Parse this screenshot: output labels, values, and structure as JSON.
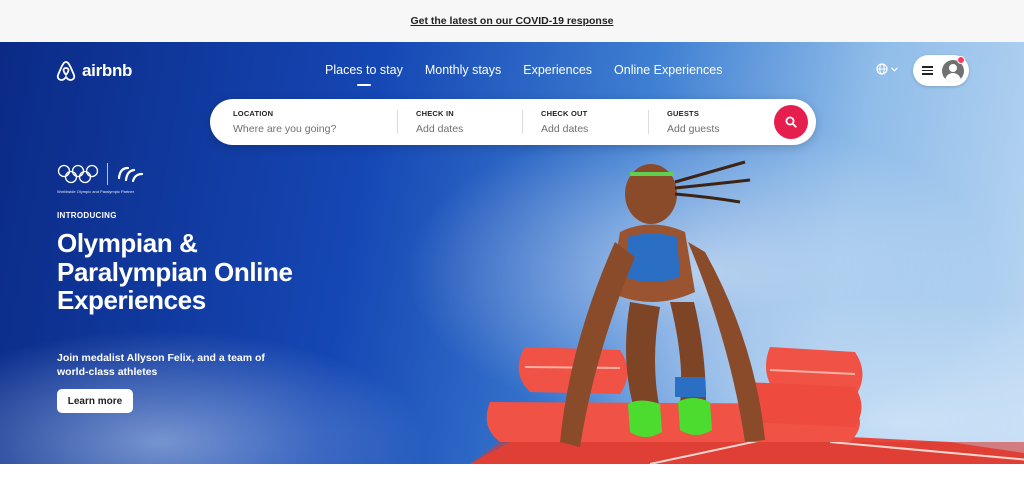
{
  "banner": {
    "text": "Get the latest on our COVID-19 response"
  },
  "header": {
    "logo_text": "airbnb",
    "nav": [
      {
        "label": "Places to stay",
        "active": true
      },
      {
        "label": "Monthly stays",
        "active": false
      },
      {
        "label": "Experiences",
        "active": false
      },
      {
        "label": "Online Experiences",
        "active": false
      }
    ],
    "icons": {
      "language": "globe-icon",
      "menu": "hamburger-icon",
      "avatar": "user-avatar-icon"
    }
  },
  "search": {
    "location": {
      "label": "LOCATION",
      "placeholder": "Where are you going?"
    },
    "check_in": {
      "label": "CHECK IN",
      "placeholder": "Add dates"
    },
    "check_out": {
      "label": "CHECK OUT",
      "placeholder": "Add dates"
    },
    "guests": {
      "label": "GUESTS",
      "placeholder": "Add guests"
    },
    "button_icon": "search-icon"
  },
  "hero": {
    "partner_caption": "Worldwide Olympic and Paralympic Partner",
    "eyebrow": "INTRODUCING",
    "title": "Olympian & Paralympian Online Experiences",
    "subtitle": "Join medalist Allyson Felix, and a team of world-class athletes",
    "cta": "Learn more"
  },
  "colors": {
    "brand": "#ff385c",
    "search_button": "#e61e4d",
    "hero_blue_dark": "#0b2a86",
    "hero_blue_light": "#b9d6f2",
    "track_red": "#e8463a"
  }
}
